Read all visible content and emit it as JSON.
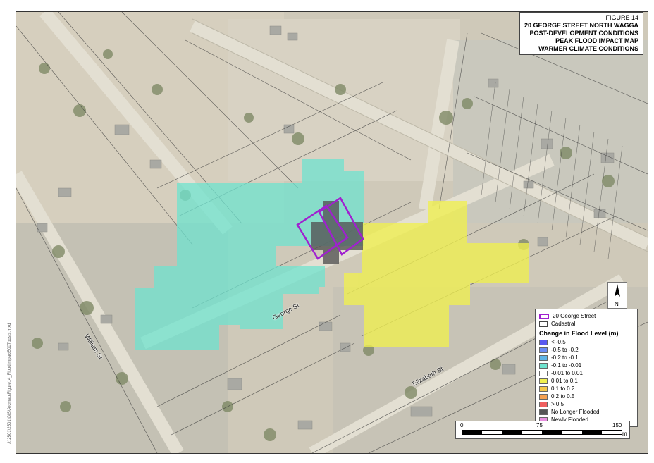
{
  "title_block": {
    "figure": "FIGURE 14",
    "line1": "20 GEORGE STREET NORTH WAGGA",
    "line2": "POST-DEVELOPMENT CONDITIONS",
    "line3": "PEAK FLOOD IMPACT MAP",
    "line4": "WARMER CLIMATE CONDITIONS"
  },
  "file_path": "J:\\2501\\2501\\GIS\\Arcmap\\Figure14_FloodImpact5007posts.mxd",
  "streets": {
    "george": "George St",
    "william": "William St",
    "elizabeth": "Elizabeth St"
  },
  "legend": {
    "site_label": "20 George Street",
    "cadastral_label": "Cadastral",
    "heading": "Change in Flood Level (m)",
    "items": [
      {
        "label": "< -0.5",
        "color": "#5a5af0"
      },
      {
        "label": "-0.5 to -0.2",
        "color": "#6b8cf5"
      },
      {
        "label": "-0.2 to -0.1",
        "color": "#5fb5e8"
      },
      {
        "label": "-0.1 to -0.01",
        "color": "#6fe3cf"
      },
      {
        "label": "-0.01 to 0.01",
        "color": "#ffffff"
      },
      {
        "label": "0.01 to 0.1",
        "color": "#f0f050"
      },
      {
        "label": "0.1 to 0.2",
        "color": "#f5c84a"
      },
      {
        "label": "0.2 to 0.5",
        "color": "#f5a050"
      },
      {
        "label": "> 0.5",
        "color": "#f06060"
      },
      {
        "label": "No Longer Flooded",
        "color": "#555555"
      },
      {
        "label": "Newly Flooded",
        "color": "#e890e0"
      }
    ],
    "site_color": "#a020d0"
  },
  "scale_bar": {
    "t0": "0",
    "t1": "75",
    "t2": "150",
    "unit": "m"
  },
  "north_arrow": {
    "label": "N"
  }
}
